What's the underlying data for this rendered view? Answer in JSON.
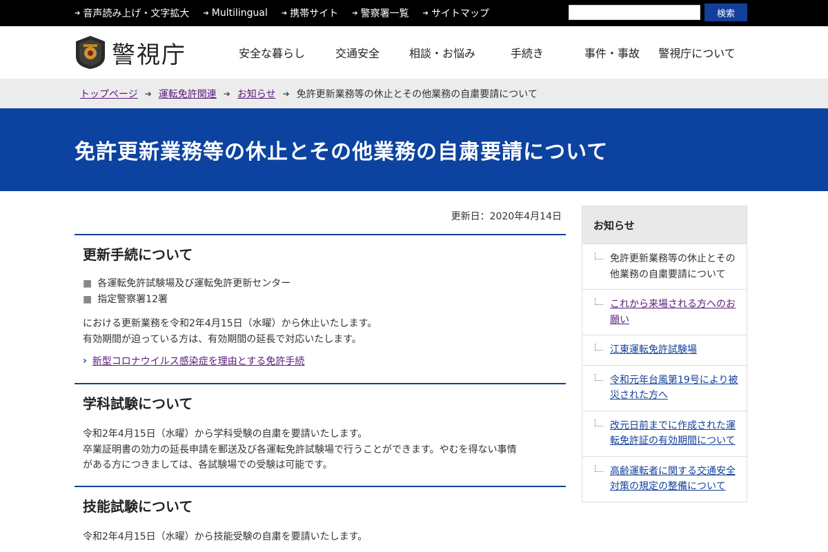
{
  "utility": {
    "links": [
      "音声読み上げ・文字拡大",
      "Multilingual",
      "携帯サイト",
      "警察署一覧",
      "サイトマップ"
    ],
    "search_placeholder": "",
    "search_button": "検索"
  },
  "header": {
    "logo_text": "警視庁",
    "nav": [
      "安全な暮らし",
      "交通安全",
      "相談・お悩み",
      "手続き",
      "事件・事故",
      "警視庁について"
    ]
  },
  "breadcrumb": {
    "links": [
      "トップページ",
      "運転免許関連",
      "お知らせ"
    ],
    "current": "免許更新業務等の休止とその他業務の自粛要請について"
  },
  "banner": {
    "title": "免許更新業務等の休止とその他業務の自粛要請について"
  },
  "main": {
    "updated": "更新日：2020年4月14日",
    "sections": [
      {
        "heading": "更新手続について",
        "bullets": [
          "各運転免許試験場及び運転免許更新センター",
          "指定警察署12署"
        ],
        "paragraph": [
          "における更新業務を令和2年4月15日（水曜）から休止いたします。",
          "有効期間が迫っている方は、有効期間の延長で対応いたします。"
        ],
        "link": "新型コロナウイルス感染症を理由とする免許手続"
      },
      {
        "heading": "学科試験について",
        "paragraph": [
          "令和2年4月15日（水曜）から学科受験の自粛を要請いたします。",
          "卒業証明書の効力の延長申請を郵送及び各運転免許試験場で行うことができます。やむを得ない事情",
          "がある方につきましては、各試験場での受験は可能です。"
        ]
      },
      {
        "heading": "技能試験について",
        "paragraph": [
          "令和2年4月15日（水曜）から技能受験の自粛を要請いたします。"
        ]
      }
    ]
  },
  "sidebar": {
    "title": "お知らせ",
    "items": [
      {
        "label": "免許更新業務等の休止とその他業務の自粛要請について",
        "link": false,
        "color": "#333333"
      },
      {
        "label": "これから来場される方へのお願い",
        "link": true,
        "color": "#5b1b7a"
      },
      {
        "label": "江東運転免許試験場",
        "link": true,
        "color": "#123f9a"
      },
      {
        "label": "令和元年台風第19号により被災された方へ",
        "link": true,
        "color": "#123f9a"
      },
      {
        "label": "改元日前までに作成された運転免許証の有効期間について",
        "link": true,
        "color": "#123f9a"
      },
      {
        "label": "高齢運転者に関する交通安全対策の規定の整備について",
        "link": true,
        "color": "#123f9a"
      }
    ]
  },
  "colors": {
    "primary": "#0d43a0",
    "visited_link": "#5b1b7a",
    "breadcrumb_bg": "#ececec",
    "topbar": "#000000"
  }
}
